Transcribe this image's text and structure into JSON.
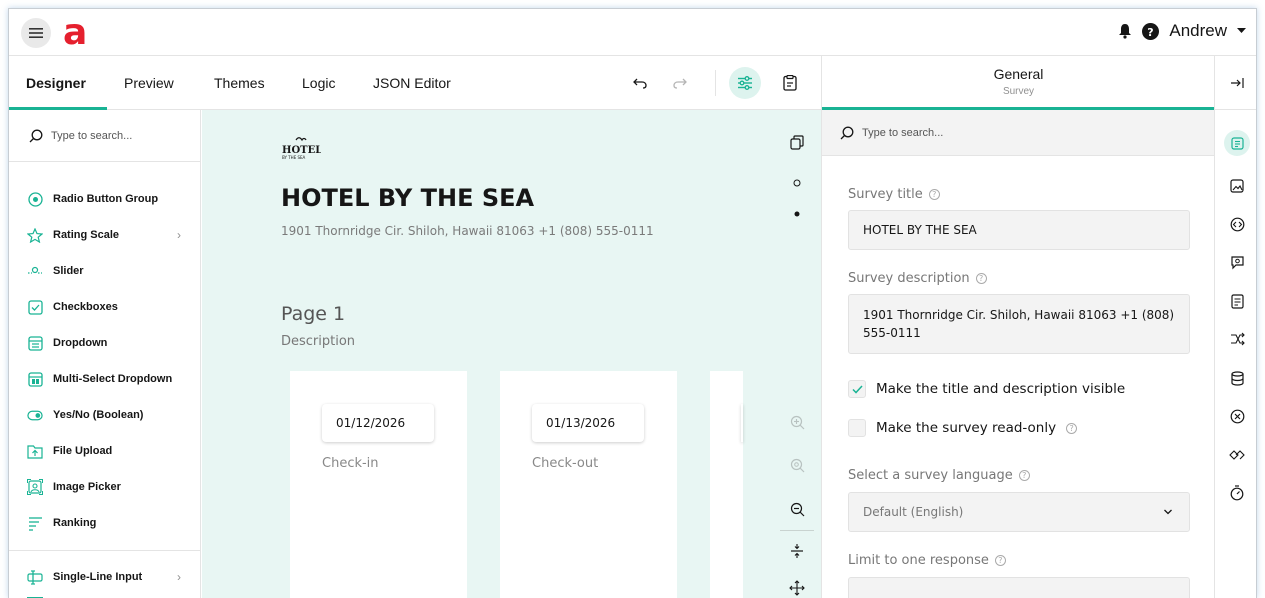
{
  "header": {
    "logo_letter": "a",
    "user_name": "Andrew"
  },
  "tabs": [
    {
      "label": "Designer",
      "active": true
    },
    {
      "label": "Preview"
    },
    {
      "label": "Themes"
    },
    {
      "label": "Logic"
    },
    {
      "label": "JSON Editor"
    }
  ],
  "toolbox": {
    "search_placeholder": "Type to search...",
    "items": [
      {
        "label": "Radio Button Group",
        "icon": "radio-icon"
      },
      {
        "label": "Rating Scale",
        "icon": "star-icon",
        "has_submenu": true
      },
      {
        "label": "Slider",
        "icon": "slider-icon"
      },
      {
        "label": "Checkboxes",
        "icon": "checkbox-icon"
      },
      {
        "label": "Dropdown",
        "icon": "dropdown-icon"
      },
      {
        "label": "Multi-Select Dropdown",
        "icon": "multiselect-icon"
      },
      {
        "label": "Yes/No (Boolean)",
        "icon": "toggle-icon"
      },
      {
        "label": "File Upload",
        "icon": "file-upload-icon"
      },
      {
        "label": "Image Picker",
        "icon": "image-picker-icon"
      },
      {
        "label": "Ranking",
        "icon": "ranking-icon"
      },
      {
        "label": "Single-Line Input",
        "icon": "text-input-icon",
        "has_submenu": true
      }
    ],
    "chevron": "›"
  },
  "canvas": {
    "logo_text_top": "HOTEL",
    "logo_text_bottom": "BY THE SEA",
    "survey_title": "HOTEL BY THE SEA",
    "survey_description": "1901 Thornridge Cir. Shiloh, Hawaii 81063 +1 (808) 555-0111",
    "page_title": "Page 1",
    "page_description": "Description",
    "questions": [
      {
        "date": "01/12/2026",
        "title": "Check-in"
      },
      {
        "date": "01/13/2026",
        "title": "Check-out"
      }
    ]
  },
  "properties": {
    "header_title": "General",
    "header_subtitle": "Survey",
    "search_placeholder": "Type to search...",
    "survey_title_label": "Survey title",
    "survey_title_value": "HOTEL BY THE SEA",
    "survey_description_label": "Survey description",
    "survey_description_value": "1901 Thornridge Cir. Shiloh, Hawaii 81063 +1 (808) 555-0111",
    "title_visible_label": "Make the title and description visible",
    "title_visible_checked": true,
    "read_only_label": "Make the survey read-only",
    "read_only_checked": false,
    "language_label": "Select a survey language",
    "language_value": "Default (English)",
    "limit_label": "Limit to one response"
  },
  "colors": {
    "accent": "#19b394",
    "logo_red": "#e5202e",
    "canvas_bg": "#e8f6f3"
  }
}
